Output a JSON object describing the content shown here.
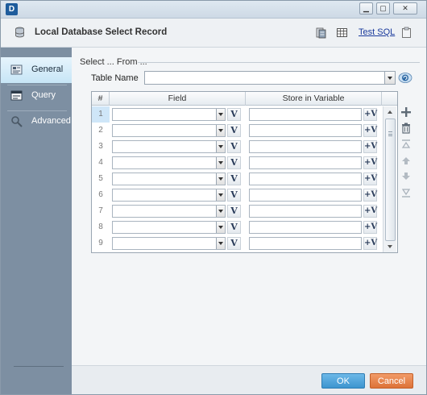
{
  "window": {
    "logo_text": "D",
    "minimize_glyph": "▁",
    "maximize_glyph": "▢",
    "close_glyph": "✕"
  },
  "header": {
    "title": "Local Database Select Record",
    "icon": "database-icon",
    "tools": [
      "database-stack-icon",
      "table-grid-icon"
    ],
    "test_sql_label": "Test SQL",
    "clipboard_icon": "clipboard-icon"
  },
  "sidebar": {
    "items": [
      {
        "label": "General",
        "icon": "general-icon",
        "active": true
      },
      {
        "label": "Query",
        "icon": "query-icon",
        "active": false
      },
      {
        "label": "Advanced",
        "icon": "advanced-icon",
        "active": false
      }
    ]
  },
  "main": {
    "section_title": "Select ... From ...",
    "table_name_label": "Table Name",
    "table_name_value": "",
    "grid": {
      "columns": [
        "#",
        "Field",
        "Store in Variable"
      ],
      "rows": [
        {
          "num": "1",
          "field": "",
          "variable": "",
          "selected": true
        },
        {
          "num": "2",
          "field": "",
          "variable": ""
        },
        {
          "num": "3",
          "field": "",
          "variable": ""
        },
        {
          "num": "4",
          "field": "",
          "variable": ""
        },
        {
          "num": "5",
          "field": "",
          "variable": ""
        },
        {
          "num": "6",
          "field": "",
          "variable": ""
        },
        {
          "num": "7",
          "field": "",
          "variable": ""
        },
        {
          "num": "8",
          "field": "",
          "variable": ""
        },
        {
          "num": "9",
          "field": "",
          "variable": ""
        }
      ],
      "field_button_glyph": "V",
      "variable_button_glyph": "+V"
    },
    "side_tools": [
      "add-icon",
      "delete-icon",
      "move-top-icon",
      "move-up-icon",
      "move-down-icon",
      "move-bottom-icon"
    ]
  },
  "footer": {
    "ok_label": "OK",
    "cancel_label": "Cancel"
  },
  "colors": {
    "sidebar": "#7d8fa2",
    "ok_button": "#4ba3db",
    "cancel_button": "#e5824a",
    "link": "#1a3a9c"
  }
}
